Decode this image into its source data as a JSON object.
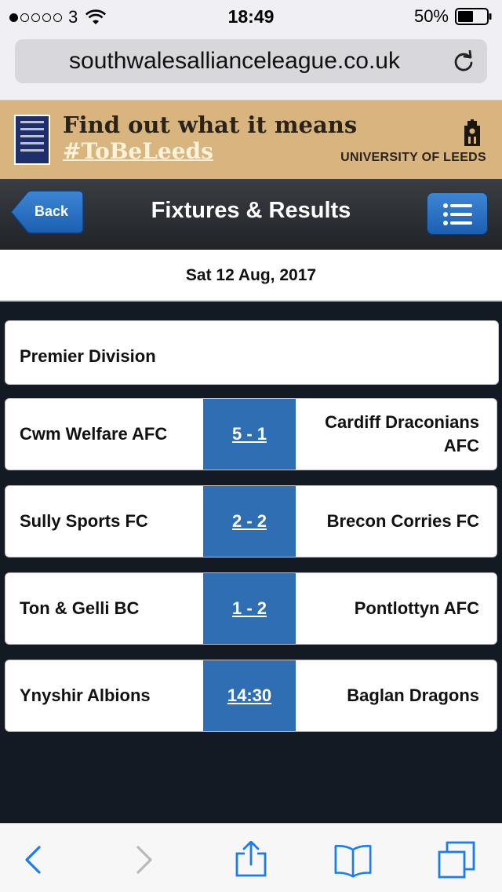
{
  "status_bar": {
    "carrier": "3",
    "time": "18:49",
    "battery": "50%"
  },
  "browser": {
    "url": "southwalesallianceleague.co.uk"
  },
  "ad": {
    "headline": "Find out what it means",
    "hashtag": "#ToBeLeeds",
    "university": "UNIVERSITY OF LEEDS"
  },
  "header": {
    "back_label": "Back",
    "title": "Fixtures & Results"
  },
  "date": "Sat 12 Aug, 2017",
  "division": "Premier Division",
  "fixtures": [
    {
      "home": "Cwm Welfare AFC",
      "score": "5 - 1",
      "away": "Cardiff Draconians AFC"
    },
    {
      "home": "Sully Sports FC",
      "score": "2 - 2",
      "away": "Brecon Corries FC"
    },
    {
      "home": "Ton & Gelli BC",
      "score": "1 - 2",
      "away": "Pontlottyn AFC"
    },
    {
      "home": "Ynyshir Albions",
      "score": "14:30",
      "away": "Baglan Dragons"
    }
  ],
  "colors": {
    "header_bg": "#2c2f34",
    "score_bg": "#2f6eb2",
    "page_bg": "#131a24",
    "ad_bg": "#d8b57f",
    "ios_blue": "#1a7cf5"
  },
  "icons": {
    "wifi": "wifi-icon",
    "battery": "battery-icon",
    "reload": "reload-icon",
    "menu": "list-menu-icon",
    "toolbar": [
      "back-arrow-icon",
      "forward-arrow-icon",
      "share-icon",
      "bookmarks-icon",
      "tabs-icon"
    ]
  }
}
